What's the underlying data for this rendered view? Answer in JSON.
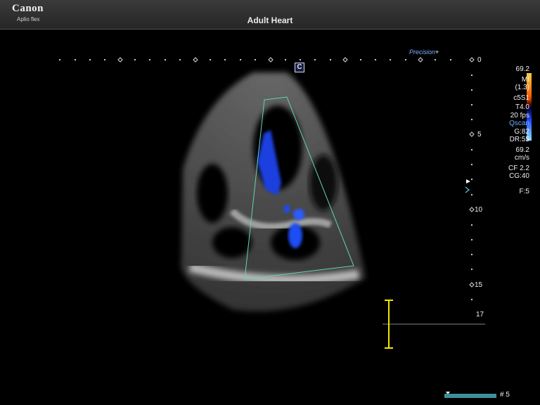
{
  "header": {
    "brand": "Canon",
    "model": "Aplio flex",
    "exam_title": "Adult Heart"
  },
  "scan_markers": {
    "precision_label": "Precision",
    "precision_plus": "+",
    "c_marker": "C"
  },
  "depth_scale": {
    "labels": [
      "0",
      "5",
      "10",
      "15",
      "17"
    ]
  },
  "parameters": {
    "velocity_top": "69.2",
    "mi_label": "MI",
    "mi_value": "(1.3)",
    "probe": "c5S1",
    "frequency": "T4.0",
    "frame_rate": "20 fps",
    "qscan": "Qscan",
    "gain": "G:82",
    "dynamic_range": "DR:55",
    "velocity_scale": "69.2",
    "velocity_unit": "cm/s",
    "color_flow": "CF 2.2",
    "color_gain": "CG:40",
    "focus": "F:5"
  },
  "colors": {
    "flow_red": "#ff6a00",
    "flow_blue": "#1e4dff",
    "roi_box": "#5fd8a8",
    "caliper": "#f5e400"
  },
  "footer": {
    "frame_label": "# 5"
  }
}
